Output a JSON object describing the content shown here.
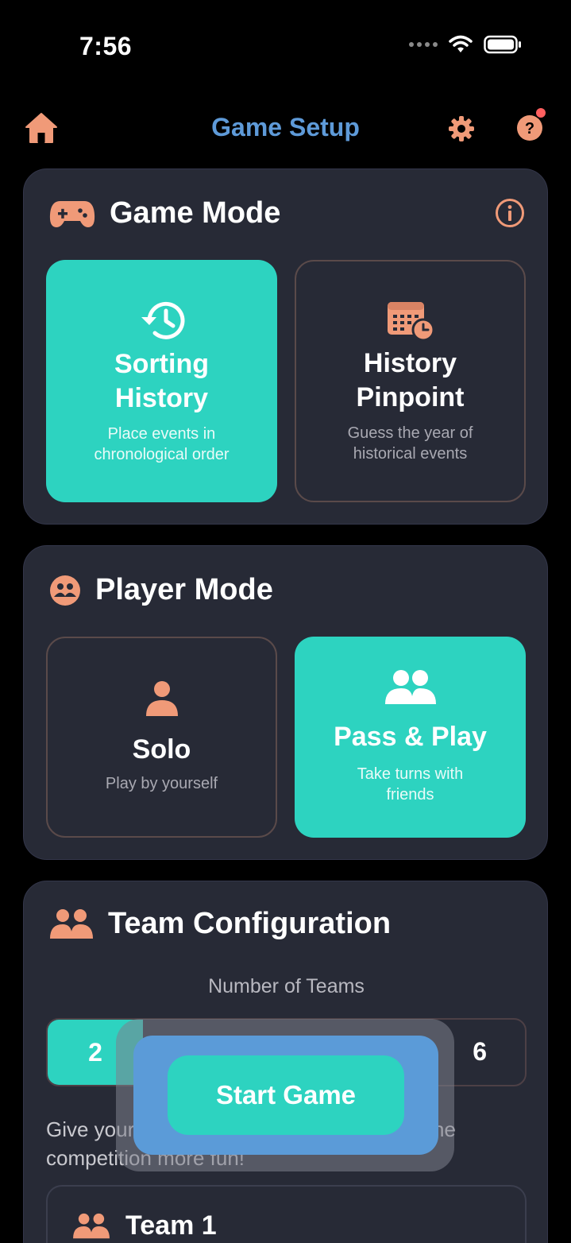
{
  "status_bar": {
    "time": "7:56"
  },
  "header": {
    "title": "Game Setup"
  },
  "game_mode": {
    "title": "Game Mode",
    "options": [
      {
        "title": "Sorting History",
        "subtitle": "Place events in chronological order",
        "selected": true
      },
      {
        "title": "History Pinpoint",
        "subtitle": "Guess the year of historical events",
        "selected": false
      }
    ]
  },
  "player_mode": {
    "title": "Player Mode",
    "options": [
      {
        "title": "Solo",
        "subtitle": "Play by yourself",
        "selected": false
      },
      {
        "title": "Pass & Play",
        "subtitle": "Take turns with friends",
        "selected": true
      }
    ]
  },
  "team_config": {
    "title": "Team Configuration",
    "number_label": "Number of Teams",
    "selected_count": "2",
    "max_count": "6",
    "description": "Give your teams creative names to make the competition more fun!",
    "teams": [
      {
        "name": "Team 1"
      }
    ]
  },
  "start_button": {
    "label": "Start Game"
  },
  "colors": {
    "accent": "#2dd3c0",
    "icon": "#f09a78",
    "title": "#5e9ad8",
    "card": "#272a36",
    "badge": "#ff5f5f"
  }
}
